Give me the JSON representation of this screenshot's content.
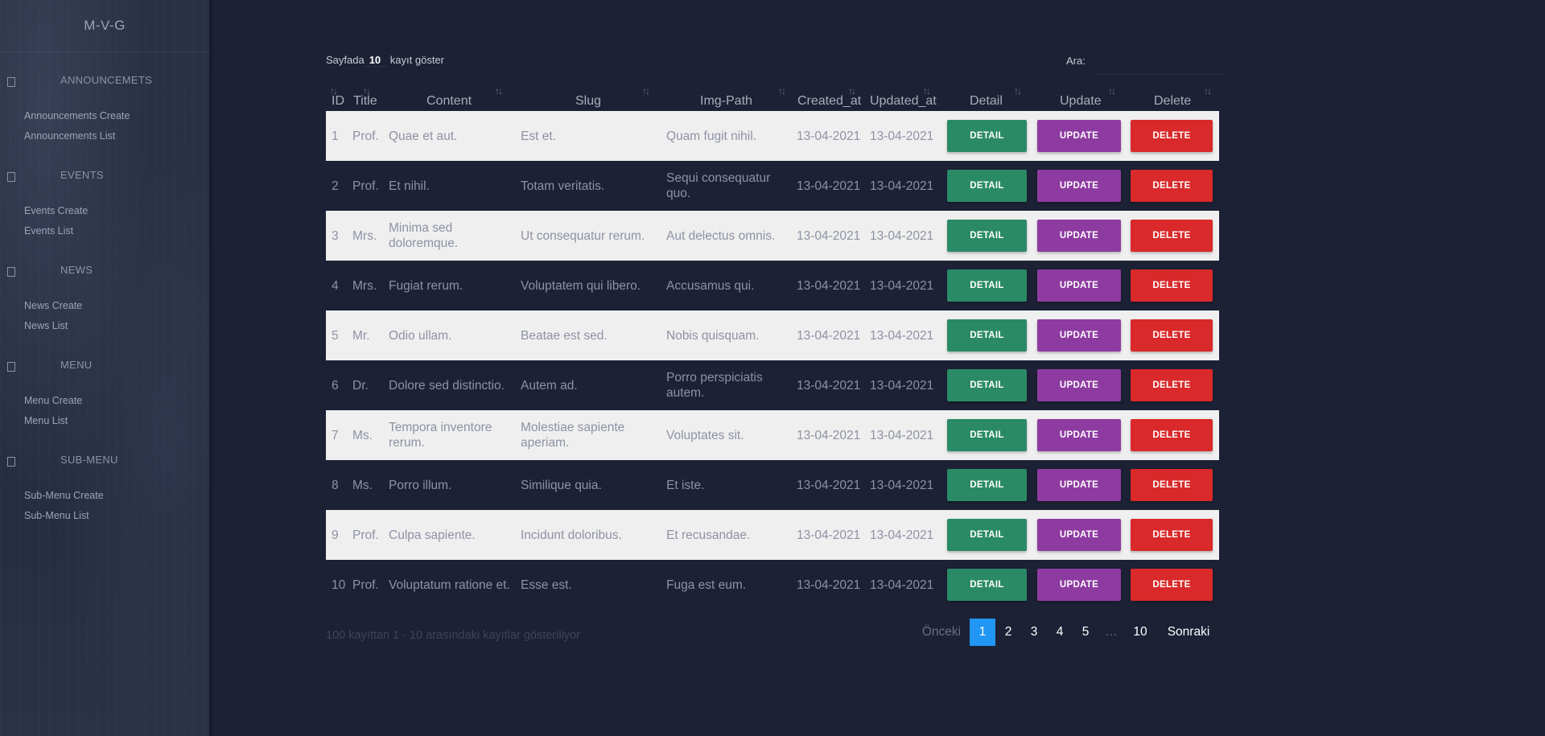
{
  "sidebar": {
    "brand": "M-V-G",
    "sections": [
      {
        "title": "ANNOUNCEMETS",
        "links": [
          "Announcements Create",
          "Announcements List"
        ]
      },
      {
        "title": "EVENTS",
        "links": [
          "Events Create",
          "Events List"
        ]
      },
      {
        "title": "NEWS",
        "links": [
          "News Create",
          "News List"
        ]
      },
      {
        "title": "MENU",
        "links": [
          "Menu Create",
          "Menu List"
        ]
      },
      {
        "title": "SUB-MENU",
        "links": [
          "Sub-Menu Create",
          "Sub-Menu List"
        ]
      }
    ]
  },
  "controls": {
    "length_prefix": "Sayfada",
    "length_value": "10",
    "length_suffix": "kayıt göster",
    "search_label": "Ara:",
    "search_value": ""
  },
  "table": {
    "headers": [
      "ID",
      "Title",
      "Content",
      "Slug",
      "Img-Path",
      "Created_at",
      "Updated_at",
      "Detail",
      "Update",
      "Delete"
    ],
    "buttons": {
      "detail": "DETAIL",
      "update": "UPDATE",
      "delete": "DELETE"
    },
    "rows": [
      {
        "id": "1",
        "title": "Prof.",
        "content": "Quae et aut.",
        "slug": "Est et.",
        "img": "Quam fugit nihil.",
        "created": "13-04-2021",
        "updated": "13-04-2021"
      },
      {
        "id": "2",
        "title": "Prof.",
        "content": "Et nihil.",
        "slug": "Totam veritatis.",
        "img": "Sequi consequatur quo.",
        "created": "13-04-2021",
        "updated": "13-04-2021"
      },
      {
        "id": "3",
        "title": "Mrs.",
        "content": "Minima sed doloremque.",
        "slug": "Ut consequatur rerum.",
        "img": "Aut delectus omnis.",
        "created": "13-04-2021",
        "updated": "13-04-2021"
      },
      {
        "id": "4",
        "title": "Mrs.",
        "content": "Fugiat rerum.",
        "slug": "Voluptatem qui libero.",
        "img": "Accusamus qui.",
        "created": "13-04-2021",
        "updated": "13-04-2021"
      },
      {
        "id": "5",
        "title": "Mr.",
        "content": "Odio ullam.",
        "slug": "Beatae est sed.",
        "img": "Nobis quisquam.",
        "created": "13-04-2021",
        "updated": "13-04-2021"
      },
      {
        "id": "6",
        "title": "Dr.",
        "content": "Dolore sed distinctio.",
        "slug": "Autem ad.",
        "img": "Porro perspiciatis autem.",
        "created": "13-04-2021",
        "updated": "13-04-2021"
      },
      {
        "id": "7",
        "title": "Ms.",
        "content": "Tempora inventore rerum.",
        "slug": "Molestiae sapiente aperiam.",
        "img": "Voluptates sit.",
        "created": "13-04-2021",
        "updated": "13-04-2021"
      },
      {
        "id": "8",
        "title": "Ms.",
        "content": "Porro illum.",
        "slug": "Similique quia.",
        "img": "Et iste.",
        "created": "13-04-2021",
        "updated": "13-04-2021"
      },
      {
        "id": "9",
        "title": "Prof.",
        "content": "Culpa sapiente.",
        "slug": "Incidunt doloribus.",
        "img": "Et recusandae.",
        "created": "13-04-2021",
        "updated": "13-04-2021"
      },
      {
        "id": "10",
        "title": "Prof.",
        "content": "Voluptatum ratione et.",
        "slug": "Esse est.",
        "img": "Fuga est eum.",
        "created": "13-04-2021",
        "updated": "13-04-2021"
      }
    ]
  },
  "footer": {
    "info": "100 kayıttan 1 - 10 arasındaki kayıtlar gösteriliyor",
    "pager": {
      "prev": "Önceki",
      "pages": [
        "1",
        "2",
        "3",
        "4",
        "5",
        "…",
        "10"
      ],
      "active": "1",
      "next": "Sonraki"
    }
  }
}
